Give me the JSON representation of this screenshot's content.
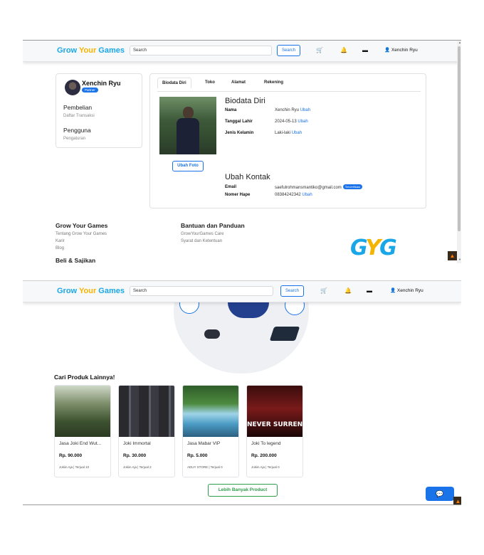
{
  "navbar": {
    "brand_grow": "Grow",
    "brand_your": "Your",
    "brand_games": "Games",
    "search_placeholder": "Search",
    "search_button": "Search",
    "cart_icon": "cart-icon",
    "bell_icon": "bell-icon",
    "inbox_icon": "inbox-icon",
    "user_glyph": "👤",
    "user_name": "Xenchin Ryu"
  },
  "profile_card": {
    "name": "Xenchin Ryu",
    "badge": "Partner",
    "section_purchase": "Pembelian",
    "link_transactions": "Daftar Transaksi",
    "section_user": "Pengguna",
    "link_settings": "Pengaturan"
  },
  "tabs": [
    "Biodata Diri",
    "Toko",
    "Alamat",
    "Rekening"
  ],
  "biodata": {
    "title": "Biodata Diri",
    "change_photo": "Ubah Foto",
    "fields": [
      {
        "label": "Nama",
        "value": "Xenchin Ryu",
        "action": "Ubah"
      },
      {
        "label": "Tanggal Lahir",
        "value": "2024-05-13",
        "action": "Ubah"
      },
      {
        "label": "Jenis Kelamin",
        "value": "Laki-laki",
        "action": "Ubah"
      }
    ]
  },
  "contact": {
    "title": "Ubah Kontak",
    "fields": [
      {
        "label": "Email",
        "value": "saefulrohmansmantiko@gmail.com",
        "badge": "Terverifikasi"
      },
      {
        "label": "Nomer Hape",
        "value": "08384242342",
        "action": "Ubah"
      }
    ]
  },
  "footer": {
    "col1_title": "Grow Your Games",
    "col1_links": [
      "Tentang Grow Your Games",
      "Karir",
      "Blog"
    ],
    "col1_sub": "Beli & Sajikan",
    "col2_title": "Bantuan dan Panduan",
    "col2_links": [
      "GrowYourGames Care",
      "Syarat dan Ketentuan"
    ],
    "logo_text": "GYG"
  },
  "products_section": {
    "title": "Cari Produk Lainnya!",
    "items": [
      {
        "name": "Jasa Joki End Wut...",
        "price": "Rp. 90.000",
        "seller": "Jokiin Aja | Terjual 10"
      },
      {
        "name": "Joki Immortal",
        "price": "Rp. 30.000",
        "seller": "Jokiin Aja | Terjual 2"
      },
      {
        "name": "Jasa Mabar VIP",
        "price": "Rp. 5.000",
        "seller": "ADUY STORE | Terjual 0"
      },
      {
        "name": "Joki To legend",
        "price": "Rp. 200.000",
        "seller": "Jokiin Aja | Terjual 0"
      }
    ],
    "more_button": "Lebih Banyak Product",
    "poster_text": "NEVER SURREND"
  },
  "colors": {
    "brand_blue": "#1aa7e8",
    "brand_yellow": "#f4b400",
    "accent": "#1a73e8",
    "green": "#2e9e4a"
  }
}
